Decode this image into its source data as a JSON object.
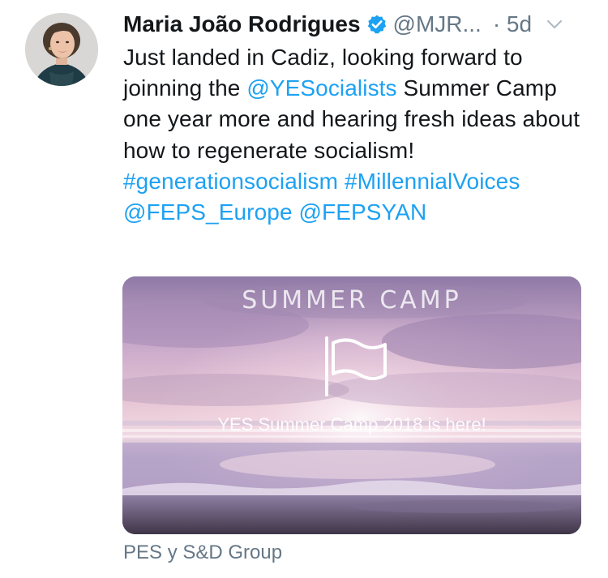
{
  "author": {
    "display_name": "Maria João Rodrigues",
    "handle": "@MJR...",
    "time": "· 5d",
    "verified": true,
    "avatar_icon": "profile-photo"
  },
  "tweet": {
    "segments": [
      {
        "text": "Just landed in Cadiz, looking forward to joinning the ",
        "kind": "text"
      },
      {
        "text": "@YESocialists",
        "kind": "link"
      },
      {
        "text": "  Summer Camp one year more and hearing fresh ideas about how to regenerate socialism! ",
        "kind": "text"
      },
      {
        "text": "#generationsocialism",
        "kind": "link"
      },
      {
        "text": " ",
        "kind": "text"
      },
      {
        "text": "#MillennialVoices",
        "kind": "link"
      },
      {
        "text": " ",
        "kind": "text"
      },
      {
        "text": "@FEPS_Europe",
        "kind": "link"
      },
      {
        "text": " ",
        "kind": "text"
      },
      {
        "text": "@FEPSYAN",
        "kind": "link"
      }
    ]
  },
  "media": {
    "title": "SUMMER CAMP",
    "caption": "YES Summer Camp 2018 is here!",
    "icon": "flag-icon"
  },
  "source": {
    "label": "PES y S&D Group"
  },
  "colors": {
    "link": "#1da1f2",
    "secondary": "#657786",
    "text": "#14171a",
    "verified": "#1da1f2"
  }
}
